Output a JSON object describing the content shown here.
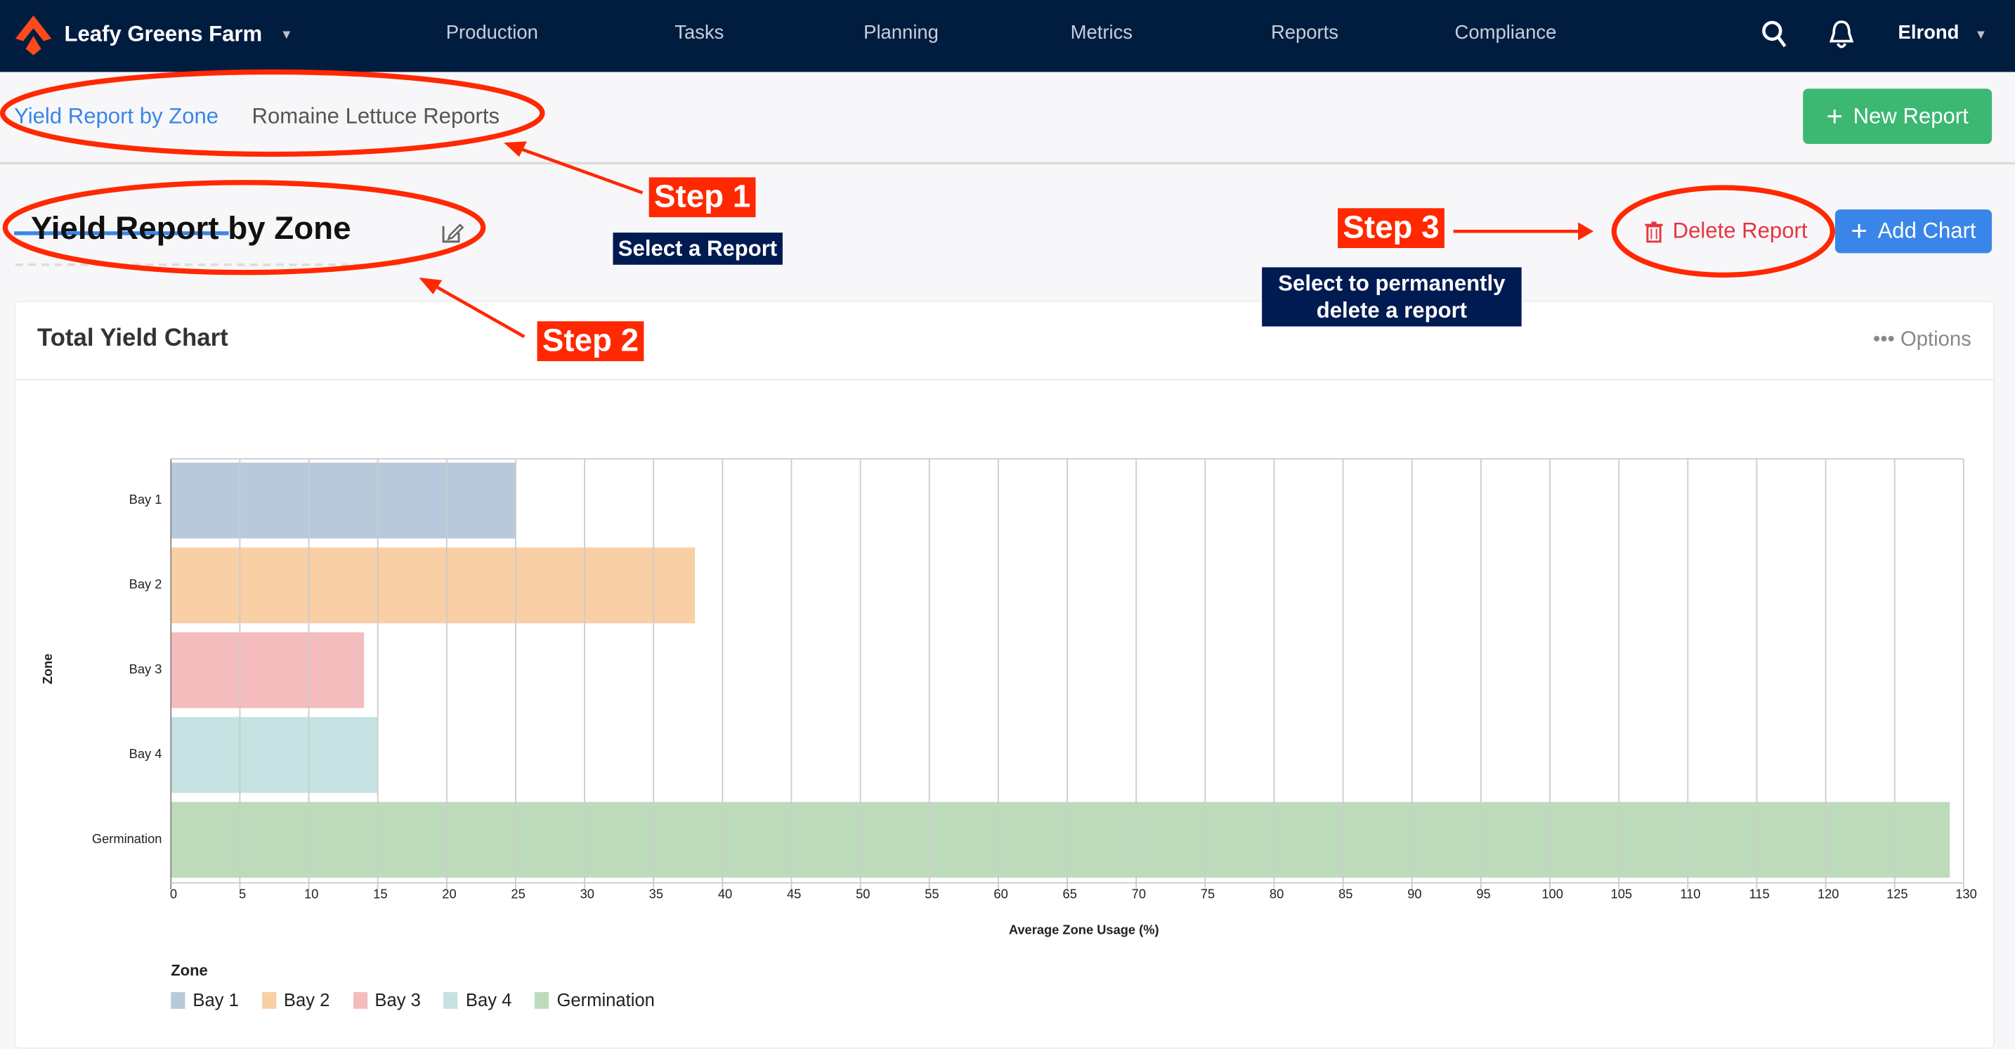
{
  "nav": {
    "brand": "Leafy Greens Farm",
    "items": [
      "Production",
      "Tasks",
      "Planning",
      "Metrics",
      "Reports",
      "Compliance"
    ],
    "user": "Elrond",
    "icons": [
      "search-icon",
      "bell-icon"
    ]
  },
  "tabs": [
    {
      "label": "Yield Report by Zone",
      "active": true
    },
    {
      "label": "Romaine Lettuce Reports",
      "active": false
    }
  ],
  "actions": {
    "new_report": "New Report",
    "delete_report": "Delete Report",
    "add_chart": "Add Chart"
  },
  "report": {
    "title": "Yield Report by Zone"
  },
  "card": {
    "title": "Total Yield Chart",
    "options": "Options"
  },
  "annotations": {
    "step1": "Step 1",
    "step1_note": "Select a Report",
    "step2": "Step 2",
    "step3": "Step 3",
    "step3_note_line1": "Select to permanently",
    "step3_note_line2": "delete a report"
  },
  "colors": {
    "nav_bg": "#001d40",
    "accent": "#3a86e8",
    "new_report": "#3cb873",
    "delete": "#e8333f",
    "annotation": "#ff2800"
  },
  "chart_data": {
    "type": "bar",
    "orientation": "horizontal",
    "categories": [
      "Bay 1",
      "Bay 2",
      "Bay 3",
      "Bay 4",
      "Germination"
    ],
    "values": [
      25,
      38,
      14,
      15,
      129
    ],
    "colors": [
      "#b8c9db",
      "#f9cfa5",
      "#f4bcbd",
      "#c6e2e2",
      "#bddbba"
    ],
    "xlabel": "Average Zone Usage (%)",
    "ylabel": "Zone",
    "xlim": [
      0,
      130
    ],
    "xticks": [
      0,
      5,
      10,
      15,
      20,
      25,
      30,
      35,
      40,
      45,
      50,
      55,
      60,
      65,
      70,
      75,
      80,
      85,
      90,
      95,
      100,
      105,
      110,
      115,
      120,
      125,
      130
    ],
    "grid": true,
    "legend_title": "Zone",
    "legend_placement": "bottom-left"
  }
}
